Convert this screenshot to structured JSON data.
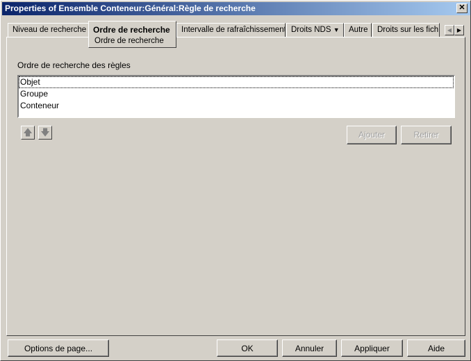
{
  "window": {
    "title": "Properties of Ensemble Conteneur:Général:Règle de recherche",
    "close": "✕"
  },
  "tabs": [
    "Niveau de recherche",
    "Ordre de recherche",
    "Intervalle de rafraîchissement",
    "Droits NDS",
    "Autre",
    "Droits sur les fich"
  ],
  "subtab": "Ordre de recherche",
  "content": {
    "label": "Ordre de recherche des règles",
    "items": [
      "Objet",
      "Groupe",
      "Conteneur"
    ],
    "add": "Ajouter",
    "remove": "Retirer"
  },
  "footer": {
    "options": "Options de page...",
    "ok": "OK",
    "cancel": "Annuler",
    "apply": "Appliquer",
    "help": "Aide"
  }
}
